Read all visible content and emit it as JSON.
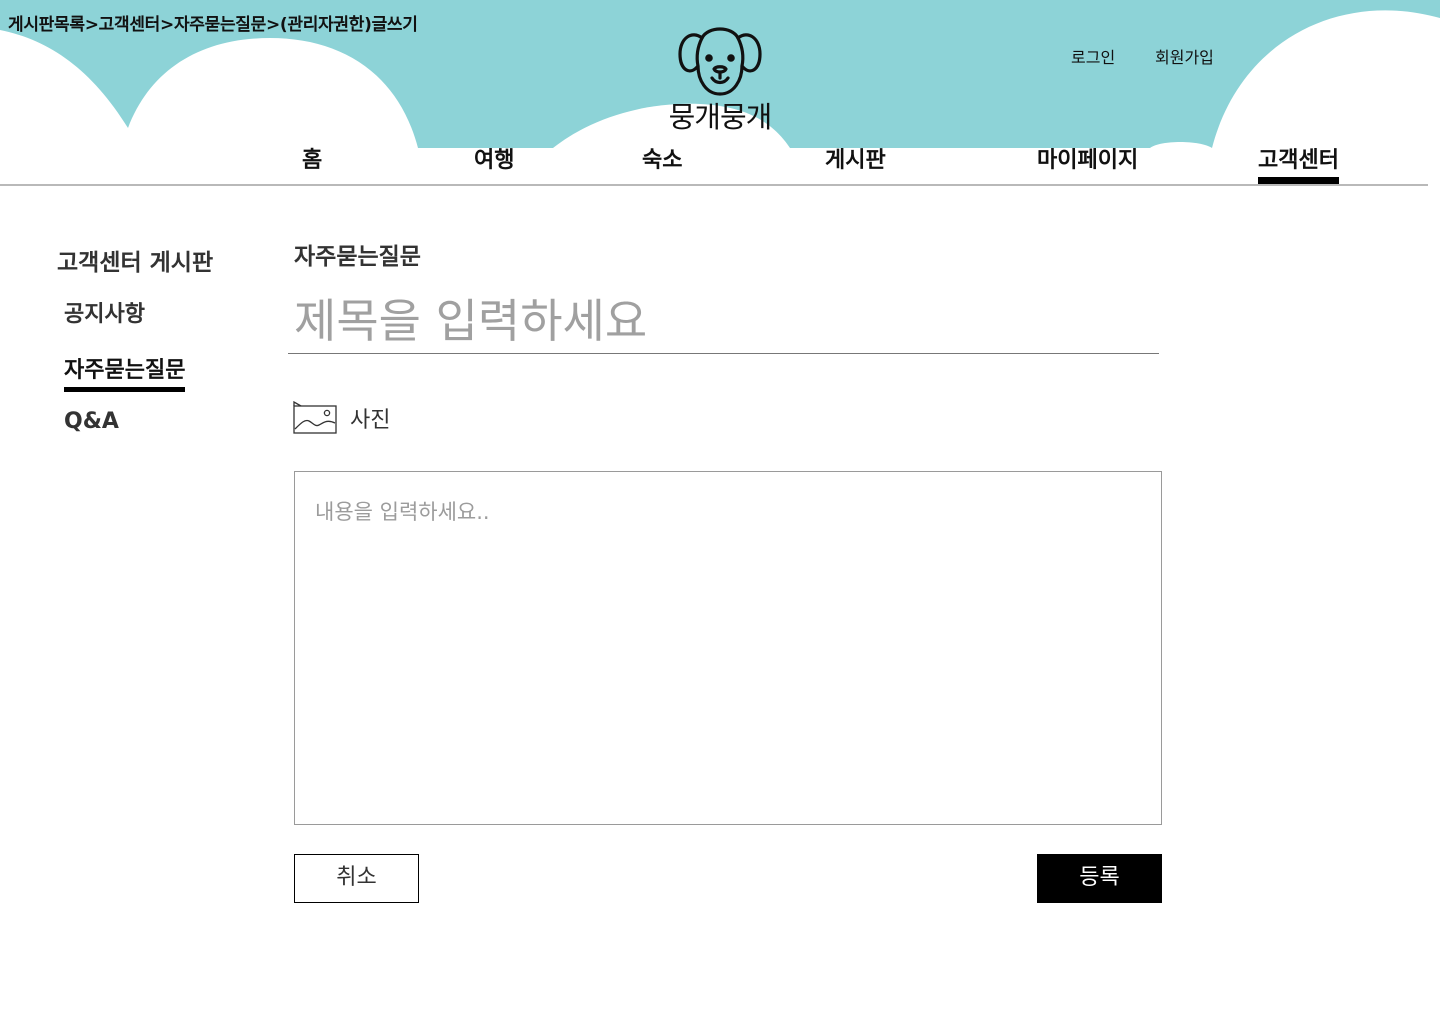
{
  "breadcrumb": "게시판목록>고객센터>자주묻는질문>(관리자권한)글쓰기",
  "brand": {
    "name": "뭉개뭉개",
    "logo_icon": "dog-face-icon",
    "header_color": "#8dd3d7"
  },
  "auth": {
    "login": "로그인",
    "signup": "회원가입"
  },
  "nav": {
    "items": [
      "홈",
      "여행",
      "숙소",
      "게시판",
      "마이페이지",
      "고객센터"
    ],
    "active": "고객센터"
  },
  "sidebar": {
    "title": "고객센터 게시판",
    "items": [
      "공지사항",
      "자주묻는질문",
      "Q&A"
    ],
    "active": "자주묻는질문"
  },
  "form": {
    "section_title": "자주묻는질문",
    "title_placeholder": "제목을 입력하세요",
    "photo_label": "사진",
    "photo_icon": "image-icon",
    "content_placeholder": "내용을 입력하세요..",
    "cancel_label": "취소",
    "submit_label": "등록"
  }
}
